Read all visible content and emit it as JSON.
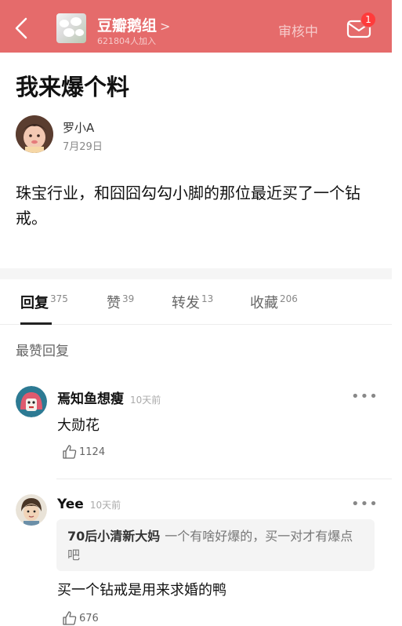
{
  "header": {
    "group_name": "豆瓣鹅组",
    "group_chevron": ">",
    "member_count": "621804人加入",
    "review_status": "审核中",
    "mail_badge": "1",
    "colors": {
      "bar": "#e56b6b",
      "badge": "#ff3b3b"
    }
  },
  "post": {
    "title": "我来爆个料",
    "author": "罗小A",
    "date": "7月29日",
    "body": "珠宝行业，和囧囧勾勾小脚的那位最近买了一个钻戒。"
  },
  "tabs": [
    {
      "label": "回复",
      "count": "375",
      "active": true
    },
    {
      "label": "赞",
      "count": "39"
    },
    {
      "label": "转发",
      "count": "13"
    },
    {
      "label": "收藏",
      "count": "206"
    }
  ],
  "section_label": "最赞回复",
  "comments": [
    {
      "name": "焉知鱼想瘦",
      "time": "10天前",
      "text": "大勋花",
      "likes": "1124",
      "more": "•••"
    },
    {
      "name": "Yee",
      "time": "10天前",
      "quote_author": "70后小清新大妈",
      "quote_text": "一个有啥好爆的，买一对才有爆点吧",
      "text": "买一个钻戒是用来求婚的鸭",
      "likes": "676",
      "more": "•••"
    }
  ]
}
